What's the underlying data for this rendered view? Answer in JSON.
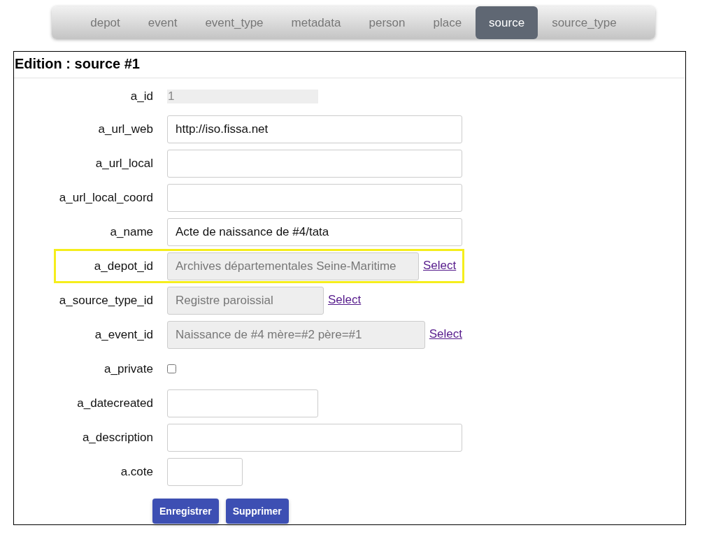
{
  "nav": {
    "tabs": [
      {
        "label": "depot",
        "selected": false
      },
      {
        "label": "event",
        "selected": false
      },
      {
        "label": "event_type",
        "selected": false
      },
      {
        "label": "metadata",
        "selected": false
      },
      {
        "label": "person",
        "selected": false
      },
      {
        "label": "place",
        "selected": false
      },
      {
        "label": "source",
        "selected": true
      },
      {
        "label": "source_type",
        "selected": false
      }
    ]
  },
  "form": {
    "title": "Edition : source #1",
    "fields": [
      {
        "kind": "static",
        "label": "a_id",
        "value": "1",
        "highlighted": false
      },
      {
        "kind": "text",
        "label": "a_url_web",
        "value": "http://iso.fissa.net",
        "highlighted": false
      },
      {
        "kind": "text",
        "label": "a_url_local",
        "highlighted": false
      },
      {
        "kind": "text",
        "label": "a_url_local_coord",
        "highlighted": false
      },
      {
        "kind": "text",
        "label": "a_name",
        "value": "Acte de naissance de #4/tata",
        "highlighted": false
      },
      {
        "kind": "lookup",
        "label": "a_depot_id",
        "value": "Archives départementales Seine-Maritime",
        "link": "Select",
        "highlighted": true
      },
      {
        "kind": "lookup",
        "label": "a_source_type_id",
        "value": "Registre paroissial",
        "link": "Select",
        "highlighted": false
      },
      {
        "kind": "lookup",
        "label": "a_event_id",
        "value": "Naissance de #4 mère=#2 père=#1",
        "link": "Select",
        "highlighted": false
      },
      {
        "kind": "checkbox",
        "label": "a_private",
        "checked": false,
        "highlighted": false
      },
      {
        "kind": "text",
        "label": "a_datecreated",
        "highlighted": false
      },
      {
        "kind": "text",
        "label": "a_description",
        "highlighted": false
      },
      {
        "kind": "text",
        "label": "a.cote",
        "highlighted": false
      }
    ],
    "buttons": [
      "Enregistrer",
      "Supprimer"
    ]
  }
}
